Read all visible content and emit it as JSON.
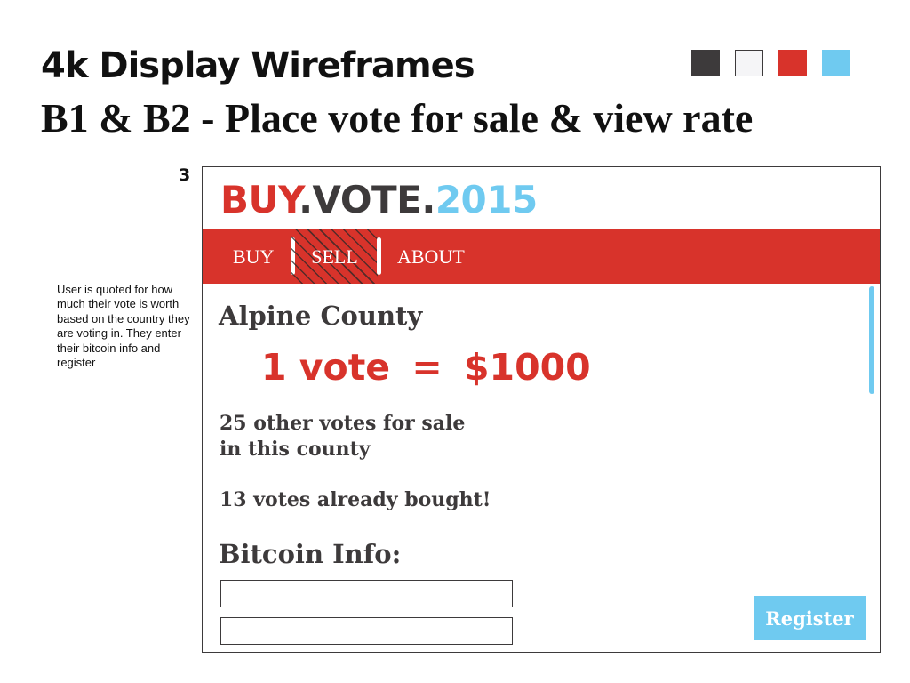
{
  "header": {
    "title": "4k Display Wireframes",
    "subtitle": "B1 & B2 - Place vote for sale & view rate"
  },
  "palette": [
    "#3d3a3b",
    "#f5f5f7",
    "#d8332b",
    "#6fcaf0"
  ],
  "screen": {
    "number": "3",
    "annotation": "User is quoted for how much their vote is worth based on the country they are voting in. They enter their bitcoin info and register"
  },
  "app": {
    "logo": {
      "part1": "BUY",
      "dot1": ".",
      "part2": "VOTE",
      "dot2": ".",
      "part3": "2015"
    },
    "nav": {
      "buy": "BUY",
      "sell": "SELL",
      "about": "ABOUT",
      "selected": "SELL"
    },
    "county": "Alpine County",
    "rate": {
      "left": "1 vote",
      "equals": "=",
      "right": "$1000"
    },
    "stats": {
      "for_sale_line1": "25 other votes for sale",
      "for_sale_line2": "in this county",
      "bought": "13 votes already bought!"
    },
    "bitcoin": {
      "label": "Bitcoin Info:",
      "field1_value": "",
      "field2_value": ""
    },
    "register_label": "Register"
  },
  "colors": {
    "dark": "#3d3a3b",
    "red": "#d8332b",
    "blue": "#6fcaf0",
    "white": "#ffffff"
  }
}
